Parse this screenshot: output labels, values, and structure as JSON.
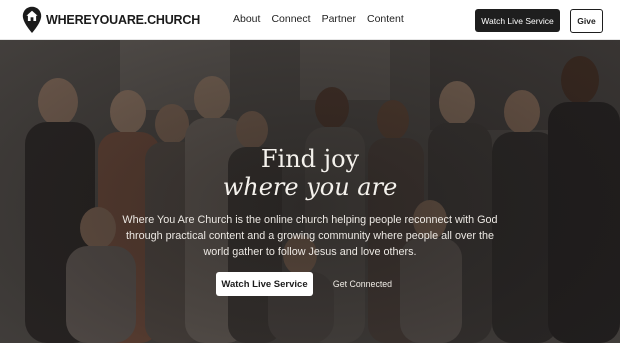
{
  "brand": {
    "name": "WHEREYOUARE.CHURCH"
  },
  "nav": {
    "items": [
      "About",
      "Connect",
      "Partner",
      "Content"
    ]
  },
  "header_buttons": {
    "watch_live": "Watch Live Service",
    "give": "Give"
  },
  "hero": {
    "headline_line1": "Find joy",
    "headline_line2": "where you are",
    "description": "Where You Are Church is the online church helping people reconnect with God through practical content and a growing community where people all over the world gather to follow Jesus and love others.",
    "primary_button": "Watch Live Service",
    "secondary_button": "Get Connected"
  },
  "colors": {
    "header_bg": "#ffffff",
    "dark_button": "#1e1e1e",
    "hero_text": "#f4f1ec"
  },
  "icons": {
    "logo": "house-pin-logo-icon"
  }
}
